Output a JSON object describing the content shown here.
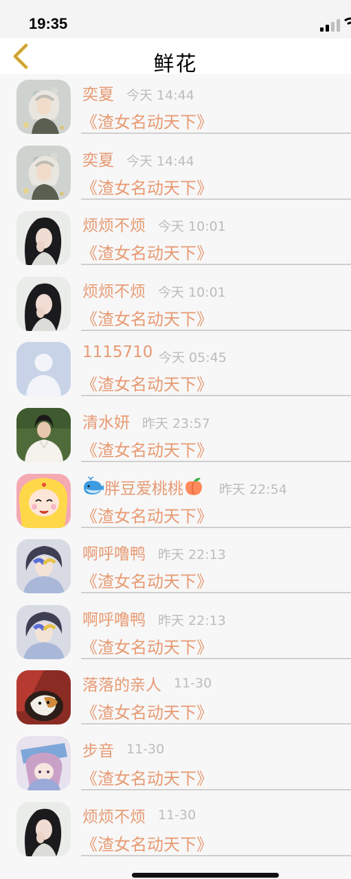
{
  "status_bar": {
    "time": "19:35"
  },
  "nav": {
    "title": "鲜花",
    "back_icon": "chevron-left-icon",
    "accent": "#e3b23c"
  },
  "colors": {
    "name": "#e79a73",
    "time": "#bcbcbc",
    "book": "#e79a73",
    "divider": "#cfcfcf"
  },
  "rows": [
    {
      "name": "奕夏",
      "time": "今天 14:44",
      "book": "《渣女名动天下》",
      "avatar": "anime-white-hair"
    },
    {
      "name": "奕夏",
      "time": "今天 14:44",
      "book": "《渣女名动天下》",
      "avatar": "anime-white-hair"
    },
    {
      "name": "烦烦不烦",
      "time": "今天 10:01",
      "book": "《渣女名动天下》",
      "avatar": "girl-black-hair"
    },
    {
      "name": "烦烦不烦",
      "time": "今天 10:01",
      "book": "《渣女名动天下》",
      "avatar": "girl-black-hair"
    },
    {
      "name": "1115710",
      "time": "今天 05:45",
      "book": "《渣女名动天下》",
      "avatar": "default-user"
    },
    {
      "name": "清水妍",
      "time": "昨天 23:57",
      "book": "《渣女名动天下》",
      "avatar": "man-white-shirt"
    },
    {
      "name": "胖豆爱桃桃",
      "time": "昨天 22:54",
      "book": "《渣女名动天下》",
      "avatar": "sailor-moon",
      "prefix_emoji": "whale-icon",
      "suffix_emoji": "peach-icon"
    },
    {
      "name": "啊呼噜鸭",
      "time": "昨天 22:13",
      "book": "《渣女名动天下》",
      "avatar": "anime-boy-blue"
    },
    {
      "name": "啊呼噜鸭",
      "time": "昨天 22:13",
      "book": "《渣女名动天下》",
      "avatar": "anime-boy-blue"
    },
    {
      "name": "落落的亲人",
      "time": "11-30",
      "book": "《渣女名动天下》",
      "avatar": "calico-cat"
    },
    {
      "name": "步音",
      "time": "11-30",
      "book": "《渣女名动天下》",
      "avatar": "anime-girl-book"
    },
    {
      "name": "烦烦不烦",
      "time": "11-30",
      "book": "《渣女名动天下》",
      "avatar": "girl-black-hair"
    }
  ]
}
